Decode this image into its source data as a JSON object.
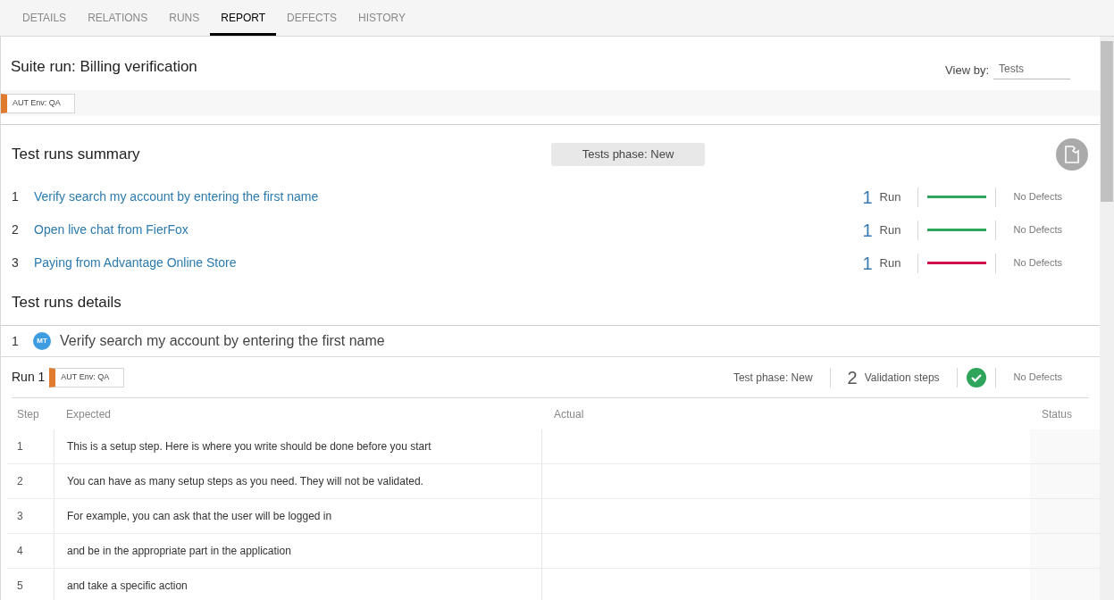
{
  "tabs": [
    {
      "label": "DETAILS",
      "selected": false
    },
    {
      "label": "RELATIONS",
      "selected": false
    },
    {
      "label": "RUNS",
      "selected": false
    },
    {
      "label": "REPORT",
      "selected": true
    },
    {
      "label": "DEFECTS",
      "selected": false
    },
    {
      "label": "HISTORY",
      "selected": false
    }
  ],
  "report": {
    "title": "Suite run: Billing verification",
    "view_by": {
      "label": "View by:",
      "value": "Tests"
    },
    "env_tag": "AUT Env: QA"
  },
  "summary": {
    "title": "Test runs summary",
    "phase": "Tests phase: New",
    "rows": [
      {
        "index": "1",
        "name": "Verify search my account by entering the first name",
        "count": "1",
        "unit": "Run",
        "color": "#2ea55a",
        "defects": "No Defects"
      },
      {
        "index": "2",
        "name": "Open live chat from FierFox",
        "count": "1",
        "unit": "Run",
        "color": "#2ea55a",
        "defects": "No Defects"
      },
      {
        "index": "3",
        "name": "Paying from Advantage Online Store",
        "count": "1",
        "unit": "Run",
        "color": "#d0104c",
        "defects": "No Defects"
      }
    ]
  },
  "details": {
    "title": "Test runs details",
    "test": {
      "index": "1",
      "badge": "MT",
      "name": "Verify search my account by entering the first name"
    },
    "run": {
      "label": "Run 1",
      "env_tag": "AUT Env: QA",
      "phase": "Test phase: New",
      "steps_count": "2",
      "steps_label": "Validation steps",
      "defects": "No Defects"
    },
    "table": {
      "columns": [
        "Step",
        "Expected",
        "Actual",
        "Status"
      ],
      "rows": [
        {
          "step": "1",
          "expected": "This is a setup step. Here is where you write should be done before you start"
        },
        {
          "step": "2",
          "expected": "You can have as many setup steps as you need. They will not be validated."
        },
        {
          "step": "3",
          "expected": "For example, you can ask that the user will be logged in"
        },
        {
          "step": "4",
          "expected": "and be in the appropriate part in the application"
        },
        {
          "step": "5",
          "expected": "and take a specific action"
        }
      ]
    }
  }
}
